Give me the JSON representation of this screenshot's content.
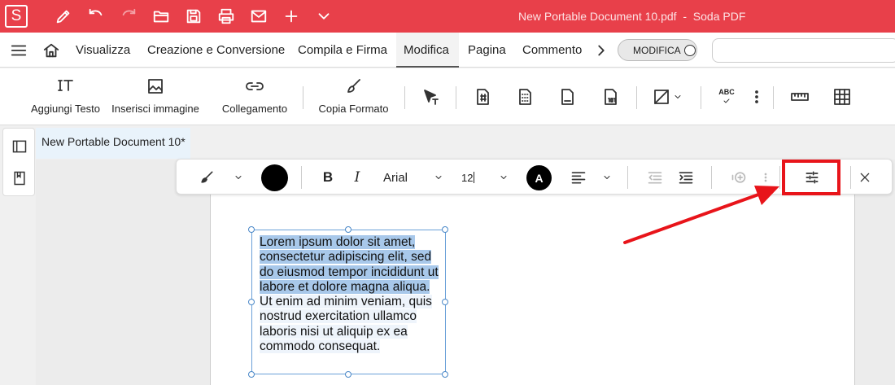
{
  "titlebar": {
    "logo": "S",
    "doc_name": "New Portable Document 10.pdf",
    "app_name": "Soda PDF",
    "separator": "-"
  },
  "menu": {
    "items": [
      "Visualizza",
      "Creazione e Conversione",
      "Compila e Firma",
      "Modifica",
      "Pagina",
      "Commento"
    ],
    "active": "Modifica",
    "mode_toggle": "MODIFICA"
  },
  "ribbon": {
    "add_text": "Aggiungi Testo",
    "insert_image": "Inserisci immagine",
    "link": "Collegamento",
    "copy_format": "Copia Formato",
    "spellcheck_label": "ABC"
  },
  "document_tab": "New Portable Document 10*",
  "format_toolbar": {
    "font": "Arial",
    "size": "12",
    "font_color_letter": "A",
    "fill_color": "#000000",
    "text_color": "#000000"
  },
  "textbox": {
    "selected_text": "Lorem ipsum dolor sit amet, consectetur adipiscing elit, sed do eiusmod tempor incididunt ut labore et dolore magna aliqua.",
    "rest_text": " Ut enim ad minim veniam, quis nostrud exercitation ullamco laboris nisi ut aliquip ex ea commodo consequat."
  },
  "colors": {
    "brand": "#e8404a",
    "highlight": "#e8141a",
    "selection": "#a8c8ea"
  }
}
